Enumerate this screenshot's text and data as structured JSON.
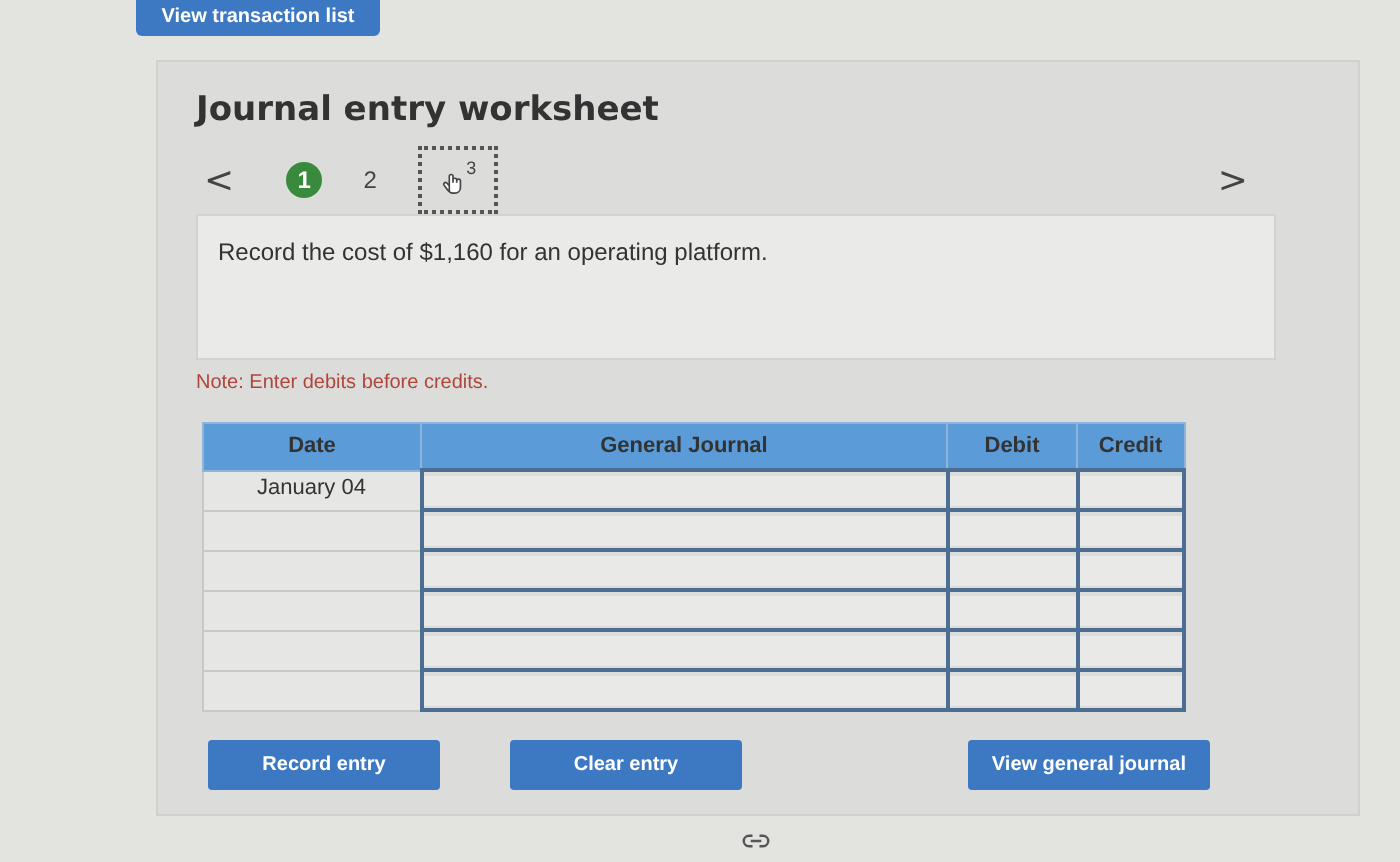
{
  "top_button": "View transaction list",
  "title": "Journal entry worksheet",
  "nav": {
    "prev": "<",
    "next": ">"
  },
  "steps": [
    {
      "label": "1",
      "kind": "number",
      "selected": true
    },
    {
      "label": "2",
      "kind": "number",
      "selected": false
    },
    {
      "label": "3",
      "kind": "hand",
      "selected": false
    }
  ],
  "prompt": "Record the cost of $1,160 for an operating platform.",
  "note": "Note: Enter debits before credits.",
  "table": {
    "columns": [
      "Date",
      "General Journal",
      "Debit",
      "Credit"
    ],
    "rows": [
      {
        "date": "January 04"
      },
      {},
      {},
      {},
      {},
      {}
    ]
  },
  "buttons": [
    {
      "label": "Record entry",
      "kind": "left"
    },
    {
      "label": "Clear entry",
      "kind": "left"
    },
    {
      "label": "View general journal",
      "kind": "right"
    }
  ]
}
